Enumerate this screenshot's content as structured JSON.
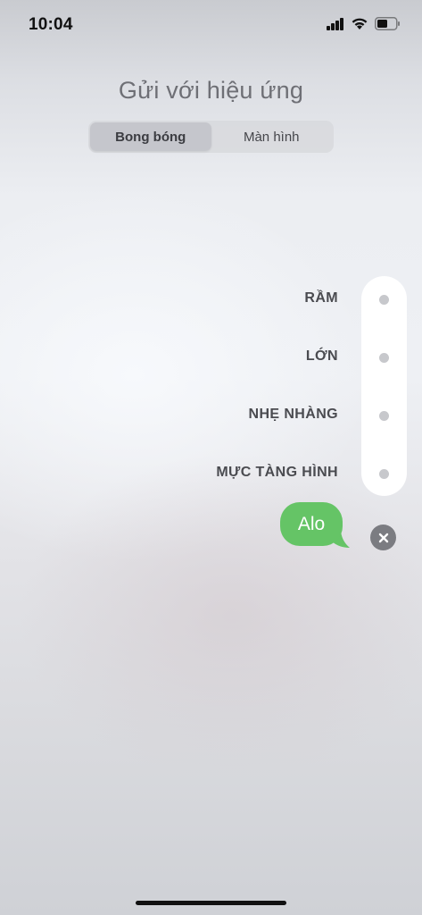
{
  "status_bar": {
    "time": "10:04",
    "icons": [
      "cellular-signal-icon",
      "wifi-icon",
      "battery-icon"
    ]
  },
  "screen": {
    "title": "Gửi với hiệu ứng"
  },
  "segmented_control": {
    "options": [
      {
        "label": "Bong bóng",
        "selected": true
      },
      {
        "label": "Màn hình",
        "selected": false
      }
    ]
  },
  "effects": [
    {
      "label": "RẦM"
    },
    {
      "label": "LỚN"
    },
    {
      "label": "NHẸ NHÀNG"
    },
    {
      "label": "MỰC TÀNG HÌNH"
    }
  ],
  "message": {
    "text": "Alo"
  },
  "colors": {
    "bubble_green": "#65c466",
    "close_gray": "#7b7c81",
    "title_gray": "#6e6f75"
  }
}
